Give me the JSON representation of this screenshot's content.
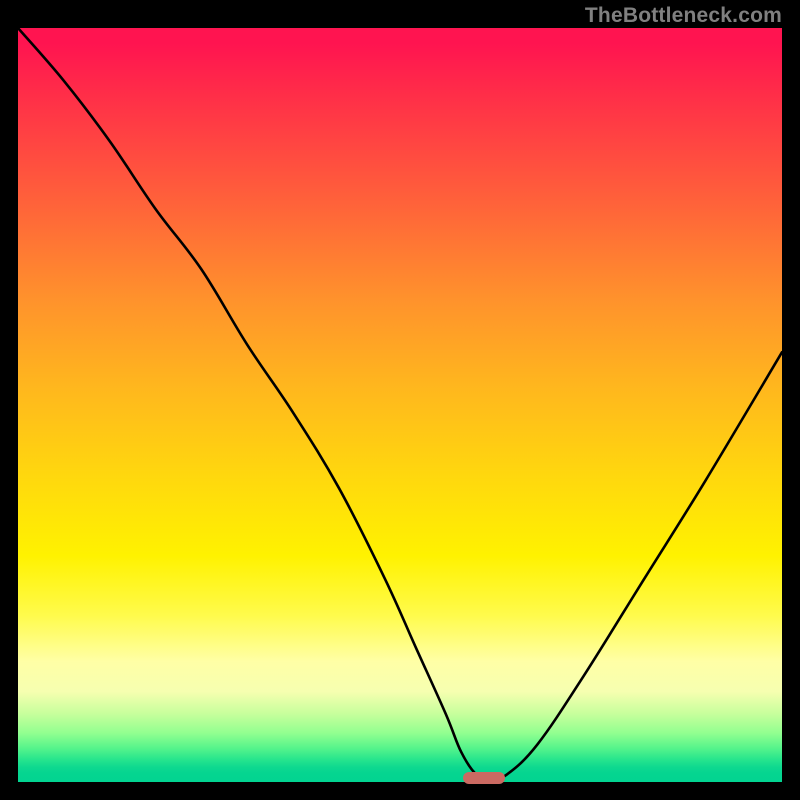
{
  "watermark": "TheBottleneck.com",
  "chart_data": {
    "type": "line",
    "title": "",
    "xlabel": "",
    "ylabel": "",
    "xlim": [
      0,
      100
    ],
    "ylim": [
      0,
      100
    ],
    "grid": false,
    "legend": false,
    "series": [
      {
        "name": "bottleneck-curve",
        "x": [
          0,
          6,
          12,
          18,
          24,
          30,
          36,
          42,
          48,
          52,
          56,
          58,
          60,
          62,
          64,
          68,
          74,
          82,
          90,
          100
        ],
        "values": [
          100,
          93,
          85,
          76,
          68,
          58,
          49,
          39,
          27,
          18,
          9,
          4,
          1,
          0.5,
          1,
          5,
          14,
          27,
          40,
          57
        ]
      }
    ],
    "marker": {
      "x": 61,
      "y": 0.5,
      "color": "#cb6a62"
    },
    "background_gradient": {
      "top": "#ff1450",
      "mid": "#ffd90d",
      "bottom": "#02d491"
    }
  }
}
